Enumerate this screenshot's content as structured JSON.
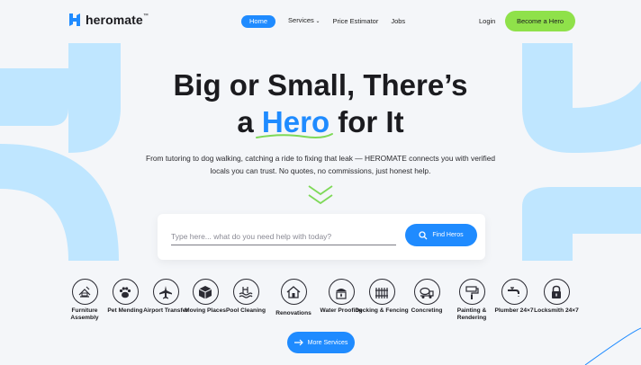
{
  "brand": {
    "name": "heromate",
    "tm": "™"
  },
  "nav": {
    "links": [
      {
        "label": "Home",
        "active": true
      },
      {
        "label": "Services",
        "has_dropdown": true
      },
      {
        "label": "Price Estimator"
      },
      {
        "label": "Jobs"
      }
    ],
    "login": "Login",
    "cta": "Become a Hero"
  },
  "hero": {
    "line1": "Big or Small, There’s",
    "line2_pre": "a ",
    "line2_highlight": "Hero",
    "line2_post": " for It",
    "subtitle": "From tutoring to dog walking, catching a ride to fixing that leak — HEROMATE connects you with verified locals you can trust. No quotes, no  commissions, just honest help."
  },
  "search": {
    "placeholder": "Type here... what do you need help with today?",
    "value": "",
    "button": "Find Heros"
  },
  "services": [
    {
      "label": "Furniture Assembly",
      "icon": "furniture-assembly-icon"
    },
    {
      "label": "Pet Mending",
      "icon": "paw-icon"
    },
    {
      "label": "Airport Transfer",
      "icon": "airplane-icon"
    },
    {
      "label": "Moving Places",
      "icon": "box-icon"
    },
    {
      "label": "Pool Cleaning",
      "icon": "pool-icon"
    },
    {
      "label": "Renovations",
      "icon": "house-icon"
    },
    {
      "label": "Water Proofing",
      "icon": "water-proofing-icon"
    },
    {
      "label": "Decking & Fencing",
      "icon": "fence-icon"
    },
    {
      "label": "Concreting",
      "icon": "concrete-truck-icon"
    },
    {
      "label": "Painting & Rendering",
      "icon": "paint-roller-icon"
    },
    {
      "label": "Plumber 24×7",
      "icon": "faucet-icon"
    },
    {
      "label": "Locksmith 24×7",
      "icon": "lock-icon"
    }
  ],
  "more_button": "More Services",
  "colors": {
    "accent": "#1f8bff",
    "cta": "#8fe14a",
    "decor": "#bfe6ff",
    "underline": "#7ed957"
  }
}
